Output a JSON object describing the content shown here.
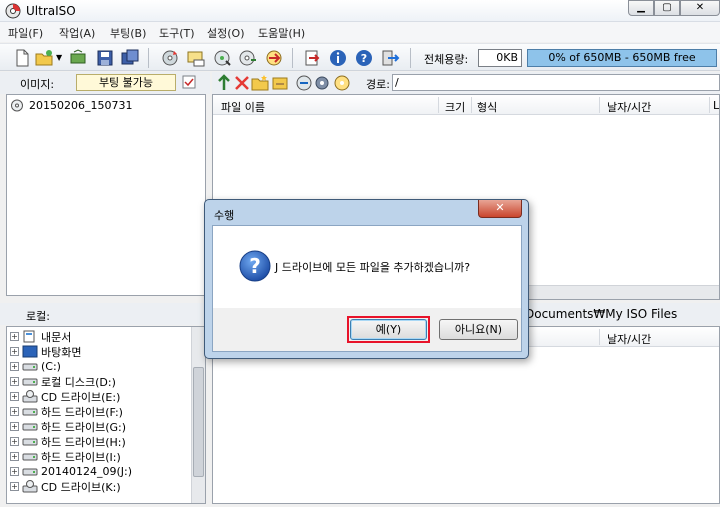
{
  "app": {
    "title": "UltraISO"
  },
  "menu": [
    "파일(F)",
    "작업(A)",
    "부팅(B)",
    "도구(T)",
    "설정(O)",
    "도움말(H)"
  ],
  "toolbar": {
    "total_label": "전체용량:",
    "size_value": "0KB",
    "capacity_text": "0% of 650MB - 650MB free"
  },
  "image_panel": {
    "label": "이미지:",
    "bootable": "부팅 불가능",
    "root_item": "20150206_150731"
  },
  "iso_panel": {
    "path_label": "경로:",
    "path_value": "/",
    "columns": [
      "파일 이름",
      "크기",
      "형식",
      "날자/시간",
      "L"
    ]
  },
  "local_panel": {
    "label": "로컬:",
    "path": "Documents₩My ISO Files",
    "columns": [
      "날자/시간"
    ],
    "tree": [
      "내문서",
      "바탕화면",
      "(C:)",
      "로컬 디스크(D:)",
      "CD 드라이브(E:)",
      "하드 드라이브(F:)",
      "하드 드라이브(G:)",
      "하드 드라이브(H:)",
      "하드 드라이브(I:)",
      "20140124_09(J:)",
      "CD 드라이브(K:)"
    ]
  },
  "dialog": {
    "title": "수행",
    "message": "J 드라이브에 모든 파일을 추가하겠습니까?",
    "yes_label": "예(Y)",
    "no_label": "아니요(N)"
  }
}
